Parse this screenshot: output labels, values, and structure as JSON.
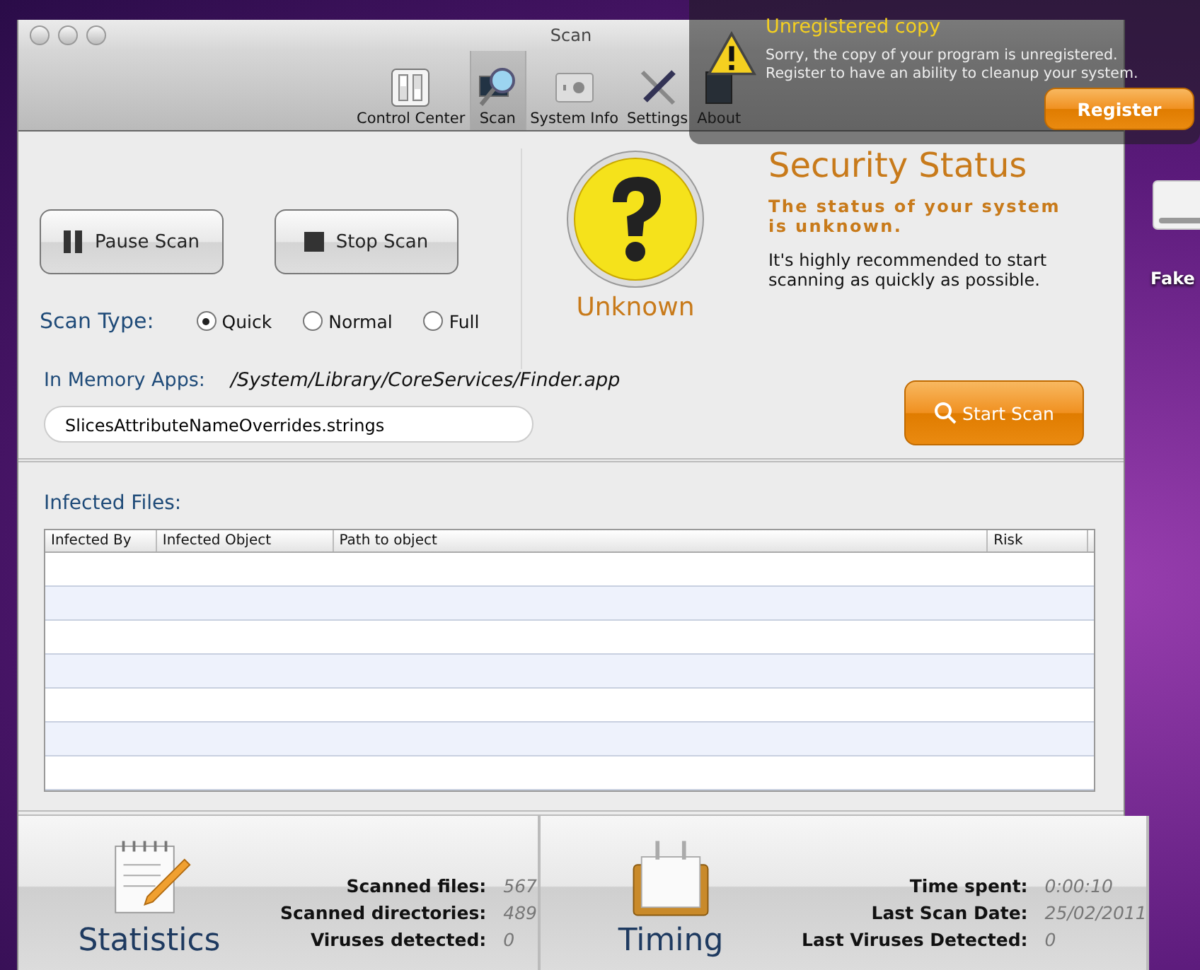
{
  "window": {
    "title": "Scan"
  },
  "toolbar": [
    {
      "label": "Control Center",
      "kind": "switches",
      "selected": false
    },
    {
      "label": "Scan",
      "kind": "magnifier",
      "selected": true
    },
    {
      "label": "System Info",
      "kind": "chip",
      "selected": false
    },
    {
      "label": "Settings",
      "kind": "tools",
      "selected": false
    },
    {
      "label": "About",
      "kind": "about",
      "selected": false
    }
  ],
  "scan_buttons": [
    {
      "label": "Pause Scan",
      "kind": "pause"
    },
    {
      "label": "Stop Scan",
      "kind": "stop"
    }
  ],
  "scan_type": {
    "label": "Scan Type:",
    "options": [
      {
        "label": "Quick",
        "selected": true
      },
      {
        "label": "Normal",
        "selected": false
      },
      {
        "label": "Full",
        "selected": false
      }
    ]
  },
  "status": {
    "badge": "Unknown",
    "title": "Security Status",
    "headline": "The status of your system is unknown.",
    "advice": "It's highly recommended to start scanning as quickly as possible."
  },
  "memory_apps": {
    "label": "In Memory Apps:",
    "path": "/System/Library/CoreServices/Finder.app",
    "current_file": "SlicesAttributeNameOverrides.strings"
  },
  "start_button": "Start Scan",
  "infected": {
    "title": "Infected Files:",
    "columns": [
      "Infected By",
      "Infected Object",
      "Path to object",
      "Risk"
    ]
  },
  "panels": [
    {
      "title": "Statistics",
      "kind": "notepad",
      "rows": [
        {
          "label": "Scanned files:",
          "value": "567"
        },
        {
          "label": "Scanned directories:",
          "value": "489"
        },
        {
          "label": "Viruses detected:",
          "value": "0"
        }
      ]
    },
    {
      "title": "Timing",
      "kind": "calendar",
      "rows": [
        {
          "label": "Time spent:",
          "value": "0:00:10"
        },
        {
          "label": "Last Scan Date:",
          "value": "25/02/2011"
        },
        {
          "label": "Last Viruses Detected:",
          "value": "0"
        }
      ]
    }
  ],
  "notification": {
    "title": "Unregistered copy",
    "message": "Sorry, the copy of your program is unregistered.\nRegister to have an ability to cleanup your system.",
    "button": "Register"
  },
  "desktop": {
    "drive_label": "Fake"
  }
}
